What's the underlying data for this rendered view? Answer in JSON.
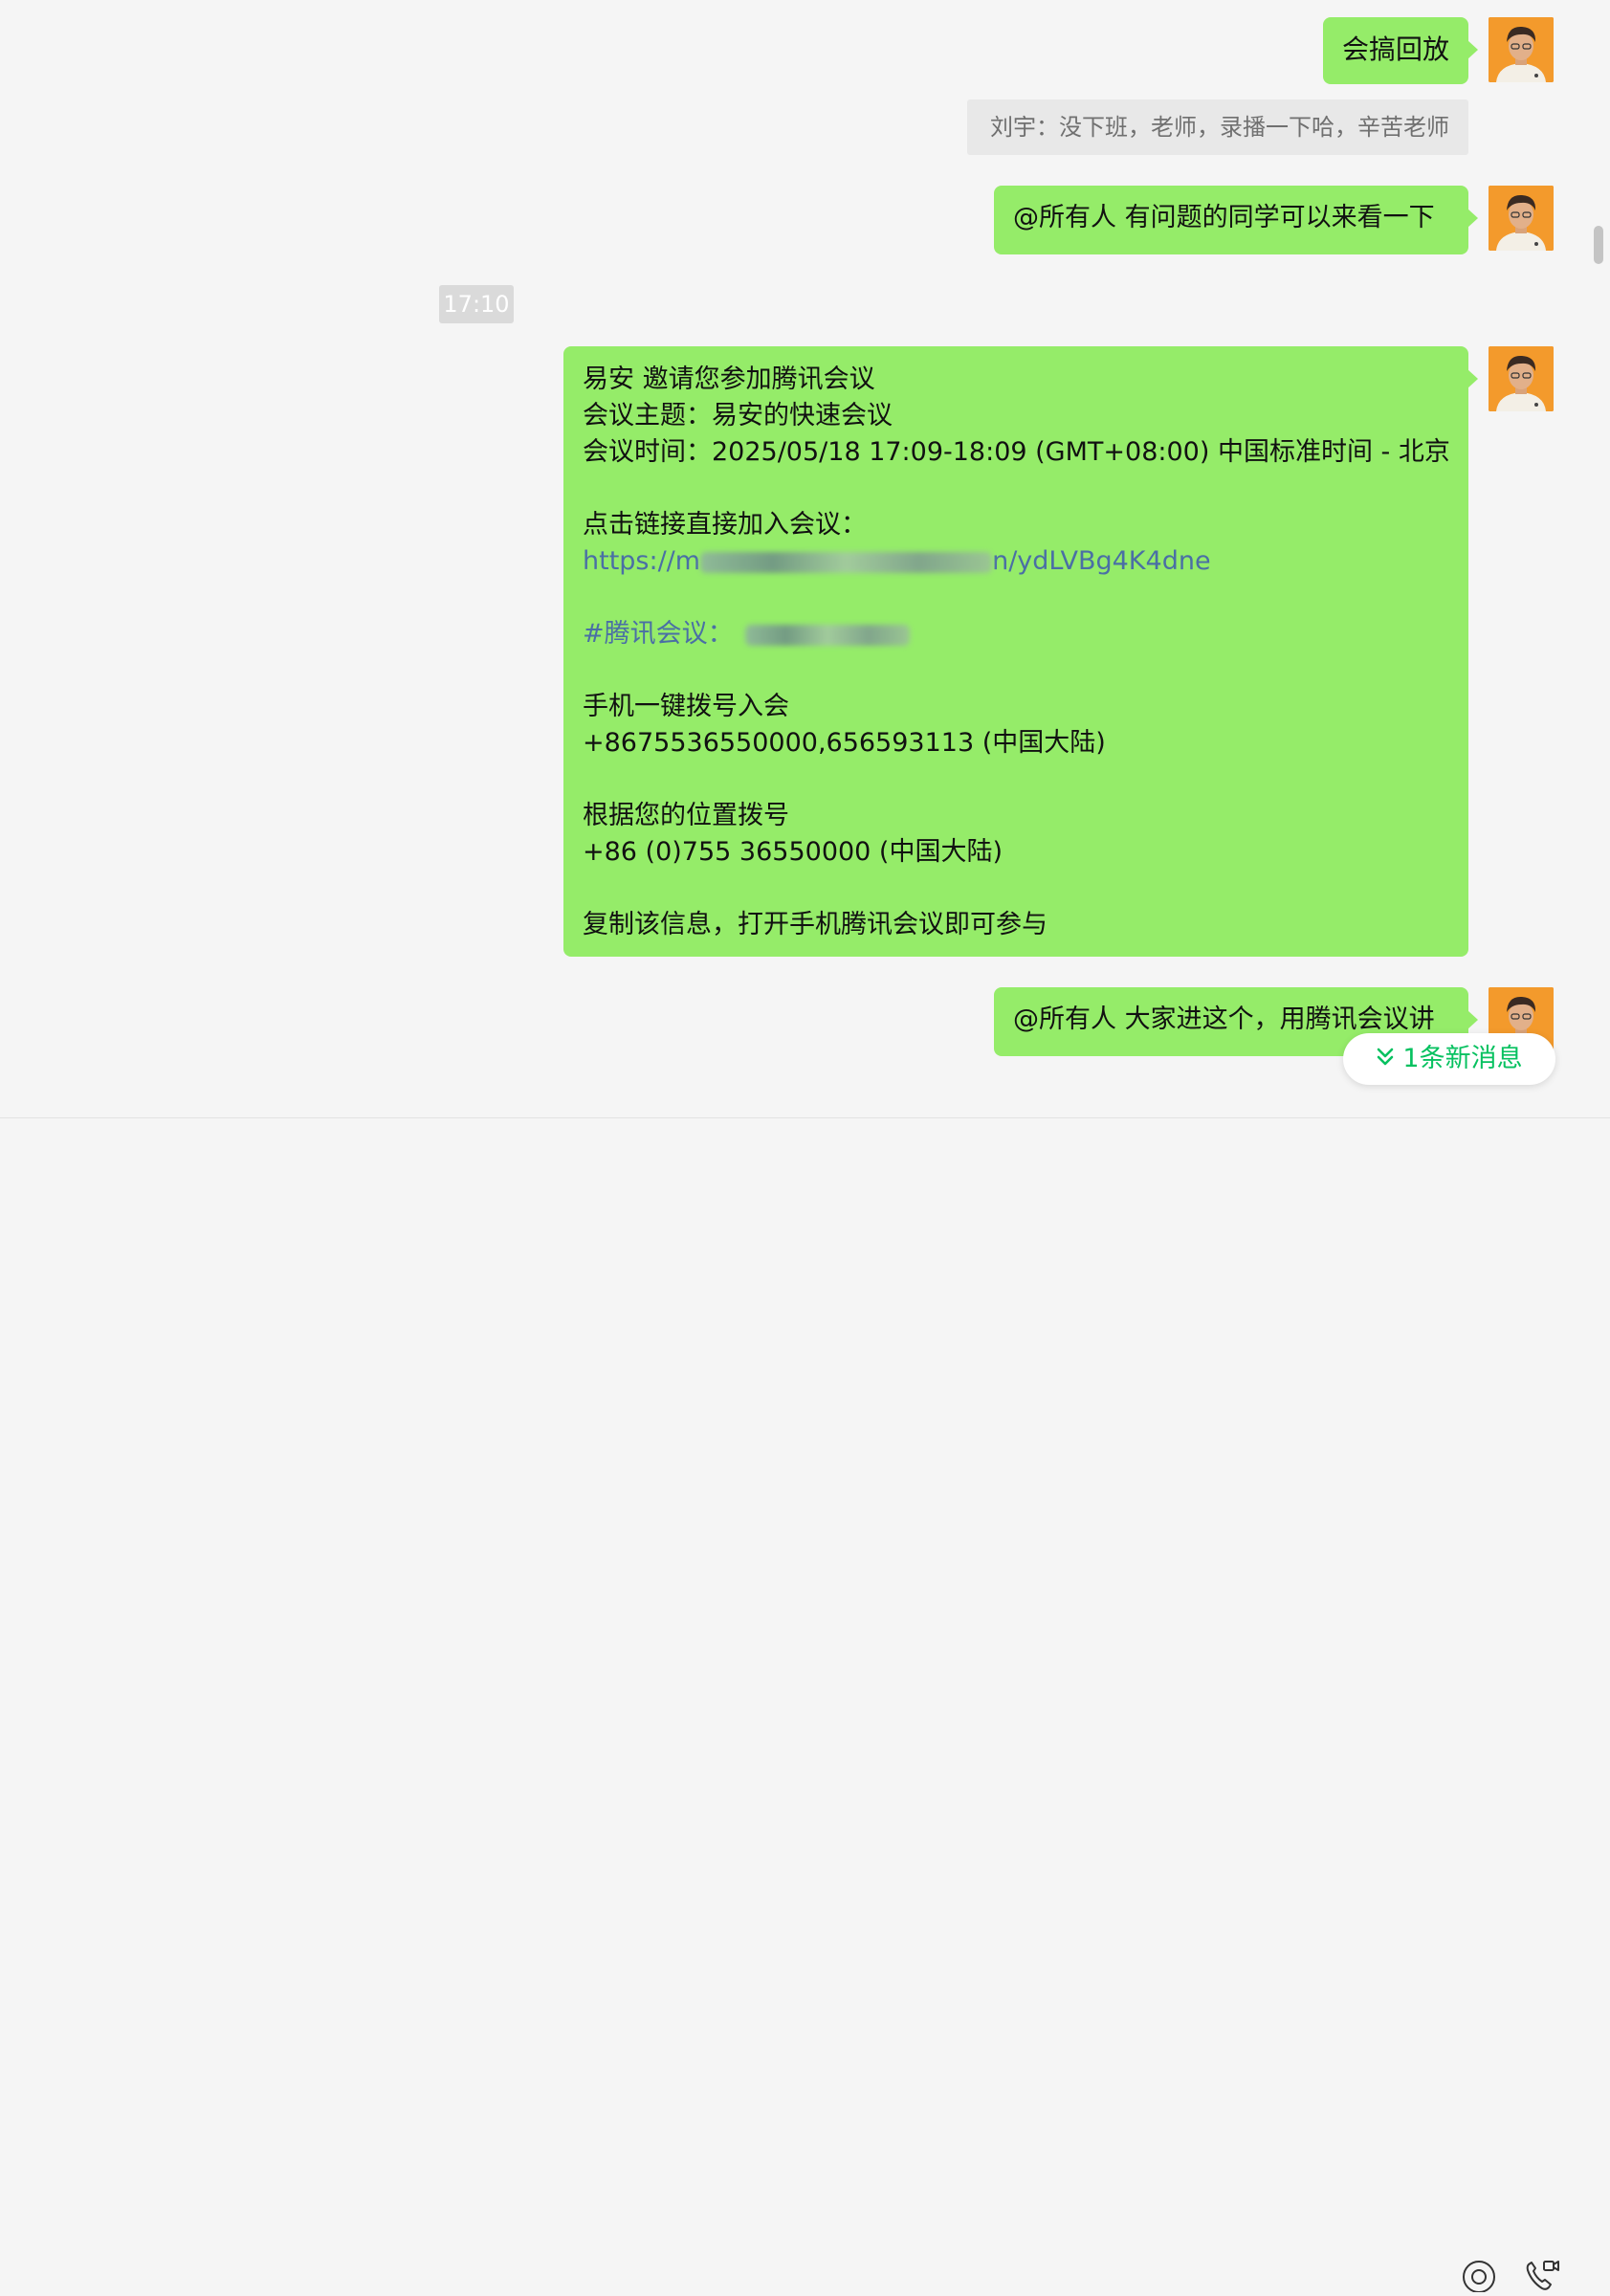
{
  "messages": {
    "m1": "会搞回放",
    "quote": "刘宇：没下班，老师，录播一下哈，辛苦老师",
    "m2": "@所有人 有问题的同学可以来看一下",
    "time": "17:10",
    "invite": {
      "l1": "易安 邀请您参加腾讯会议",
      "l2": "会议主题：易安的快速会议",
      "l3": "会议时间：2025/05/18 17:09-18:09 (GMT+08:00) 中国标准时间 - 北京",
      "l4": "点击链接直接加入会议：",
      "link_start": "https://m",
      "link_mid": "n/ydLVBg4K4dne",
      "tag": "#腾讯会议：",
      "l6": "手机一键拨号入会",
      "l7": "+8675536550000,656593113 (中国大陆)",
      "l8": "根据您的位置拨号",
      "l9": "+86 (0)755 36550000 (中国大陆)",
      "l10": "复制该信息，打开手机腾讯会议即可参与"
    },
    "m3": "@所有人 大家进这个，用腾讯会议讲"
  },
  "new_message_badge": "1条新消息",
  "colors": {
    "bubble": "#95ec69",
    "accent": "#07c160",
    "link": "#4a6fa5",
    "background": "#f5f5f5"
  },
  "icons": [
    "avatar",
    "chevron-double-down-icon",
    "live-icon",
    "voice-video-call-icon"
  ]
}
